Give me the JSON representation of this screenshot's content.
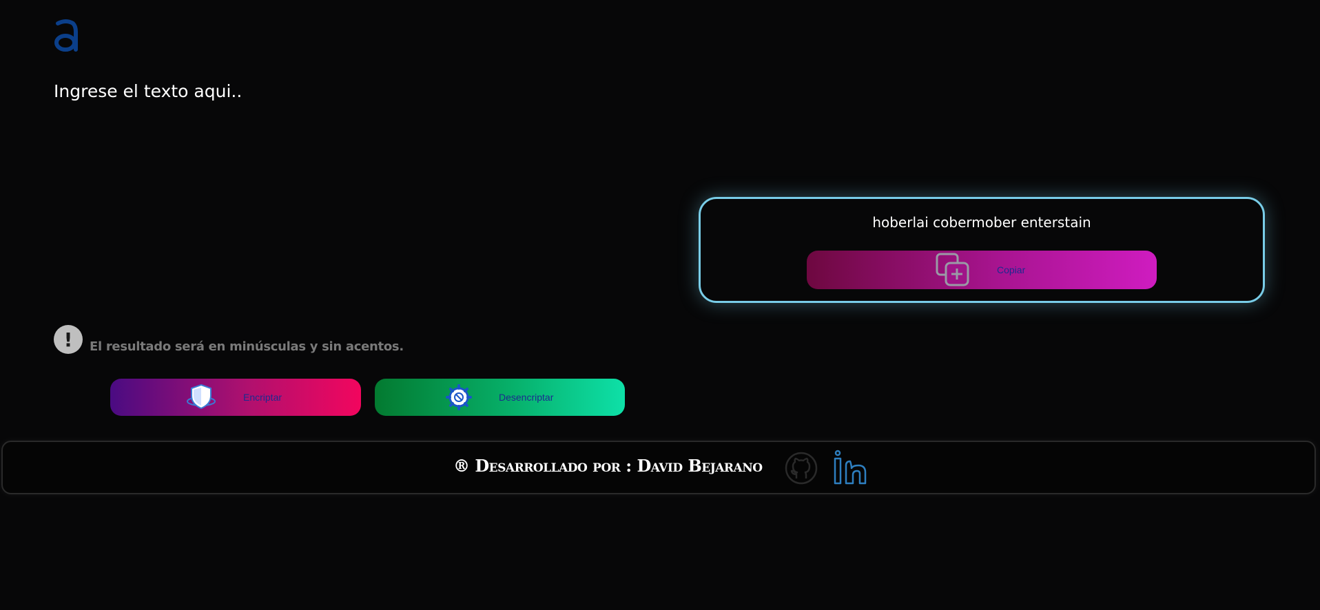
{
  "input": {
    "placeholder": "Ingrese el texto aqui.."
  },
  "notice": {
    "icon": "exclamation-icon",
    "glyph": "!",
    "text": "El resultado será en minúsculas y sin acentos."
  },
  "buttons": {
    "encrypt_label": "Encriptar",
    "encrypt_icon": "shield-icon",
    "decrypt_label": "Desencriptar",
    "decrypt_icon": "gear-icon"
  },
  "output": {
    "text": "hoberlai cobermober enterstain",
    "copy_label": "Copiar",
    "copy_icon": "copy-icon"
  },
  "footer": {
    "credit": "® Desarrollado por : David Bejarano",
    "github_icon": "github-icon",
    "linkedin_icon": "linkedin-icon"
  },
  "colors": {
    "background": "#070708",
    "output_border": "#79cde8",
    "encrypt_gradient": [
      "#4a0b82",
      "#f2065e"
    ],
    "decrypt_gradient": [
      "#037a30",
      "#0ee0a8"
    ],
    "copy_gradient": [
      "#6e0840",
      "#cf1cc0"
    ],
    "button_text": "#1c2a8f",
    "logo": "#0b3f8a"
  }
}
